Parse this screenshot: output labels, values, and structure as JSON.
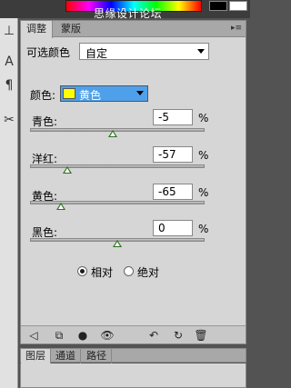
{
  "topbar": {
    "watermark": "思缘设计论坛"
  },
  "panel": {
    "tabs": [
      "调整",
      "蒙版"
    ],
    "active_tab": "调整",
    "title": "可选颜色",
    "preset": {
      "value": "自定"
    },
    "color_label": "颜色:",
    "color_value": "黄色",
    "sliders": [
      {
        "label": "青色:",
        "value": "-5",
        "fraction": 0.475
      },
      {
        "label": "洋红:",
        "value": "-57",
        "fraction": 0.215
      },
      {
        "label": "黄色:",
        "value": "-65",
        "fraction": 0.175
      },
      {
        "label": "黑色:",
        "value": "0",
        "fraction": 0.5
      }
    ],
    "unit": "%",
    "method": {
      "relative_label": "相对",
      "absolute_label": "绝对",
      "selected": "relative"
    }
  },
  "bottom": {
    "tabs": [
      "图层",
      "通道",
      "路径"
    ],
    "active_tab": "图层"
  },
  "colors": {
    "accent": "#4fa0ea",
    "chip": "#ffff00",
    "thumb": "#2e6f1e"
  }
}
